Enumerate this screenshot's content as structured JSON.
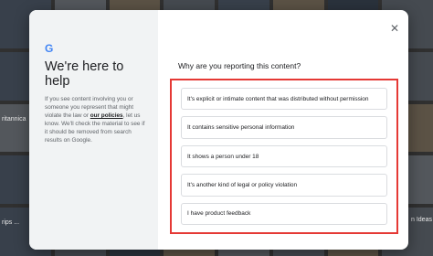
{
  "background": {
    "left_label": "ritannica",
    "right_label": "n Ideas",
    "bottom_label": "rips ..."
  },
  "dialog": {
    "logo": "G",
    "title": "We're here to help",
    "description_before_link": "If you see content involving you or someone you represent that might violate the law or ",
    "policies_link": "our policies",
    "description_after_link": ", let us know. We'll check the material to see if it should be removed from search results on Google.",
    "close_icon": "close-icon",
    "question": "Why are you reporting this content?",
    "options": [
      {
        "label": "It's explicit or intimate content that was distributed without permission"
      },
      {
        "label": "It contains sensitive personal information"
      },
      {
        "label": "It shows a person under 18"
      },
      {
        "label": "It's another kind of legal or policy violation"
      },
      {
        "label": "I have product feedback"
      }
    ]
  },
  "colors": {
    "highlight_border": "#e53935",
    "google_blue": "#4285f4"
  }
}
